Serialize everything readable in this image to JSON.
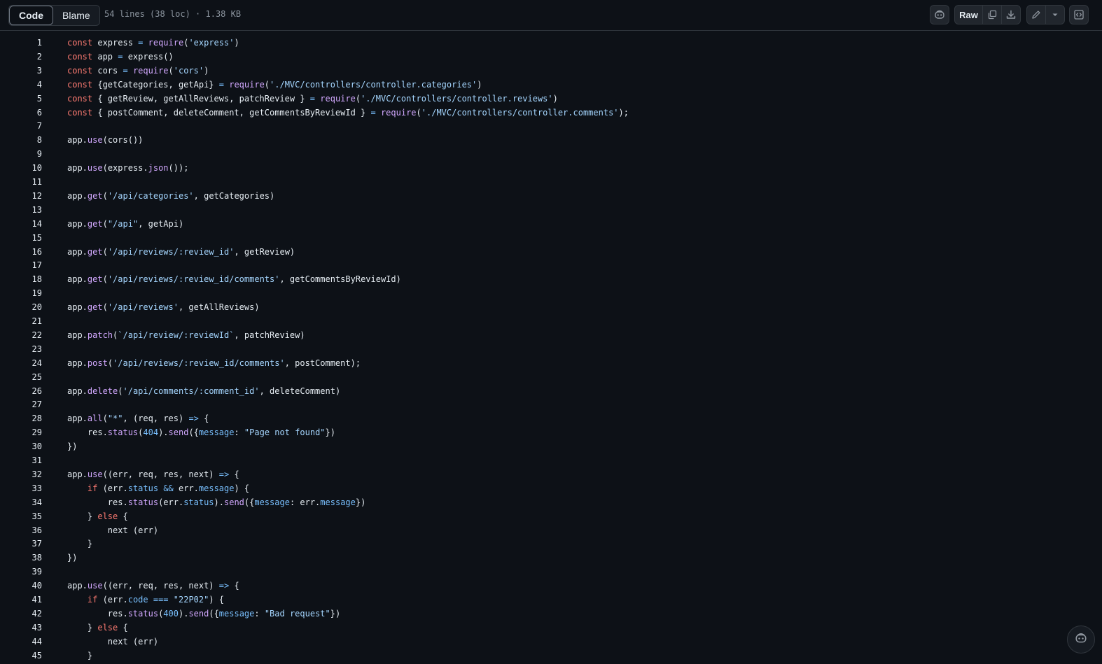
{
  "toolbar": {
    "code_tab": "Code",
    "blame_tab": "Blame",
    "file_info": "54 lines (38 loc) · 1.38 KB",
    "raw_label": "Raw",
    "icons": [
      "copilot-icon",
      "copy-icon",
      "download-icon",
      "pencil-icon",
      "triangle-down-icon",
      "code-square-icon"
    ]
  },
  "colors": {
    "background": "#0d1117",
    "keyword": "#ff7b72",
    "function": "#d2a8ff",
    "string": "#a5d6ff",
    "property": "#79c0ff",
    "text": "#e6edf3"
  },
  "code": {
    "lines": [
      {
        "n": "1",
        "tokens": [
          [
            "kw",
            "const"
          ],
          [
            "pl",
            " express "
          ],
          [
            "op",
            "="
          ],
          [
            "pl",
            " "
          ],
          [
            "fn",
            "require"
          ],
          [
            "pl",
            "("
          ],
          [
            "str",
            "'express'"
          ],
          [
            "pl",
            ")"
          ]
        ]
      },
      {
        "n": "2",
        "tokens": [
          [
            "kw",
            "const"
          ],
          [
            "pl",
            " app "
          ],
          [
            "op",
            "="
          ],
          [
            "pl",
            " express()"
          ]
        ]
      },
      {
        "n": "3",
        "tokens": [
          [
            "kw",
            "const"
          ],
          [
            "pl",
            " cors "
          ],
          [
            "op",
            "="
          ],
          [
            "pl",
            " "
          ],
          [
            "fn",
            "require"
          ],
          [
            "pl",
            "("
          ],
          [
            "str",
            "'cors'"
          ],
          [
            "pl",
            ")"
          ]
        ]
      },
      {
        "n": "4",
        "tokens": [
          [
            "kw",
            "const"
          ],
          [
            "pl",
            " {getCategories, getApi} "
          ],
          [
            "op",
            "="
          ],
          [
            "pl",
            " "
          ],
          [
            "fn",
            "require"
          ],
          [
            "pl",
            "("
          ],
          [
            "str",
            "'./MVC/controllers/controller.categories'"
          ],
          [
            "pl",
            ")"
          ]
        ]
      },
      {
        "n": "5",
        "tokens": [
          [
            "kw",
            "const"
          ],
          [
            "pl",
            " { getReview, getAllReviews, patchReview } "
          ],
          [
            "op",
            "="
          ],
          [
            "pl",
            " "
          ],
          [
            "fn",
            "require"
          ],
          [
            "pl",
            "("
          ],
          [
            "str",
            "'./MVC/controllers/controller.reviews'"
          ],
          [
            "pl",
            ")"
          ]
        ]
      },
      {
        "n": "6",
        "tokens": [
          [
            "kw",
            "const"
          ],
          [
            "pl",
            " { postComment, deleteComment, getCommentsByReviewId } "
          ],
          [
            "op",
            "="
          ],
          [
            "pl",
            " "
          ],
          [
            "fn",
            "require"
          ],
          [
            "pl",
            "("
          ],
          [
            "str",
            "'./MVC/controllers/controller.comments'"
          ],
          [
            "pl",
            ");"
          ]
        ]
      },
      {
        "n": "7",
        "tokens": []
      },
      {
        "n": "8",
        "tokens": [
          [
            "pl",
            "app."
          ],
          [
            "fn",
            "use"
          ],
          [
            "pl",
            "(cors())"
          ]
        ]
      },
      {
        "n": "9",
        "tokens": []
      },
      {
        "n": "10",
        "tokens": [
          [
            "pl",
            "app."
          ],
          [
            "fn",
            "use"
          ],
          [
            "pl",
            "(express."
          ],
          [
            "fn",
            "json"
          ],
          [
            "pl",
            "());"
          ]
        ]
      },
      {
        "n": "11",
        "tokens": []
      },
      {
        "n": "12",
        "tokens": [
          [
            "pl",
            "app."
          ],
          [
            "fn",
            "get"
          ],
          [
            "pl",
            "("
          ],
          [
            "str",
            "'/api/categories'"
          ],
          [
            "pl",
            ", getCategories)"
          ]
        ]
      },
      {
        "n": "13",
        "tokens": []
      },
      {
        "n": "14",
        "tokens": [
          [
            "pl",
            "app."
          ],
          [
            "fn",
            "get"
          ],
          [
            "pl",
            "("
          ],
          [
            "str",
            "\"/api\""
          ],
          [
            "pl",
            ", getApi)"
          ]
        ]
      },
      {
        "n": "15",
        "tokens": []
      },
      {
        "n": "16",
        "tokens": [
          [
            "pl",
            "app."
          ],
          [
            "fn",
            "get"
          ],
          [
            "pl",
            "("
          ],
          [
            "str",
            "'/api/reviews/:review_id'"
          ],
          [
            "pl",
            ", getReview)"
          ]
        ]
      },
      {
        "n": "17",
        "tokens": []
      },
      {
        "n": "18",
        "tokens": [
          [
            "pl",
            "app."
          ],
          [
            "fn",
            "get"
          ],
          [
            "pl",
            "("
          ],
          [
            "str",
            "'/api/reviews/:review_id/comments'"
          ],
          [
            "pl",
            ", getCommentsByReviewId)"
          ]
        ]
      },
      {
        "n": "19",
        "tokens": []
      },
      {
        "n": "20",
        "tokens": [
          [
            "pl",
            "app."
          ],
          [
            "fn",
            "get"
          ],
          [
            "pl",
            "("
          ],
          [
            "str",
            "'/api/reviews'"
          ],
          [
            "pl",
            ", getAllReviews)"
          ]
        ]
      },
      {
        "n": "21",
        "tokens": []
      },
      {
        "n": "22",
        "tokens": [
          [
            "pl",
            "app."
          ],
          [
            "fn",
            "patch"
          ],
          [
            "pl",
            "("
          ],
          [
            "str",
            "`/api/review/:reviewId`"
          ],
          [
            "pl",
            ", patchReview)"
          ]
        ]
      },
      {
        "n": "23",
        "tokens": []
      },
      {
        "n": "24",
        "tokens": [
          [
            "pl",
            "app."
          ],
          [
            "fn",
            "post"
          ],
          [
            "pl",
            "("
          ],
          [
            "str",
            "'/api/reviews/:review_id/comments'"
          ],
          [
            "pl",
            ", postComment);"
          ]
        ]
      },
      {
        "n": "25",
        "tokens": []
      },
      {
        "n": "26",
        "tokens": [
          [
            "pl",
            "app."
          ],
          [
            "fn",
            "delete"
          ],
          [
            "pl",
            "("
          ],
          [
            "str",
            "'/api/comments/:comment_id'"
          ],
          [
            "pl",
            ", deleteComment)"
          ]
        ]
      },
      {
        "n": "27",
        "tokens": []
      },
      {
        "n": "28",
        "tokens": [
          [
            "pl",
            "app."
          ],
          [
            "fn",
            "all"
          ],
          [
            "pl",
            "("
          ],
          [
            "str",
            "\"*\""
          ],
          [
            "pl",
            ", (req, res) "
          ],
          [
            "op",
            "=>"
          ],
          [
            "pl",
            " {"
          ]
        ]
      },
      {
        "n": "29",
        "tokens": [
          [
            "pl",
            "    res."
          ],
          [
            "fn",
            "status"
          ],
          [
            "pl",
            "("
          ],
          [
            "num",
            "404"
          ],
          [
            "pl",
            ")."
          ],
          [
            "fn",
            "send"
          ],
          [
            "pl",
            "({"
          ],
          [
            "prop",
            "message"
          ],
          [
            "pl",
            ": "
          ],
          [
            "str",
            "\"Page not found\""
          ],
          [
            "pl",
            "})"
          ]
        ]
      },
      {
        "n": "30",
        "tokens": [
          [
            "pl",
            "})"
          ]
        ]
      },
      {
        "n": "31",
        "tokens": []
      },
      {
        "n": "32",
        "tokens": [
          [
            "pl",
            "app."
          ],
          [
            "fn",
            "use"
          ],
          [
            "pl",
            "((err, req, res, next) "
          ],
          [
            "op",
            "=>"
          ],
          [
            "pl",
            " {"
          ]
        ]
      },
      {
        "n": "33",
        "tokens": [
          [
            "pl",
            "    "
          ],
          [
            "kw",
            "if"
          ],
          [
            "pl",
            " (err."
          ],
          [
            "prop",
            "status"
          ],
          [
            "pl",
            " "
          ],
          [
            "op",
            "&&"
          ],
          [
            "pl",
            " err."
          ],
          [
            "prop",
            "message"
          ],
          [
            "pl",
            ") {"
          ]
        ]
      },
      {
        "n": "34",
        "tokens": [
          [
            "pl",
            "        res."
          ],
          [
            "fn",
            "status"
          ],
          [
            "pl",
            "(err."
          ],
          [
            "prop",
            "status"
          ],
          [
            "pl",
            ")."
          ],
          [
            "fn",
            "send"
          ],
          [
            "pl",
            "({"
          ],
          [
            "prop",
            "message"
          ],
          [
            "pl",
            ": err."
          ],
          [
            "prop",
            "message"
          ],
          [
            "pl",
            "})"
          ]
        ]
      },
      {
        "n": "35",
        "tokens": [
          [
            "pl",
            "    } "
          ],
          [
            "kw",
            "else"
          ],
          [
            "pl",
            " {"
          ]
        ]
      },
      {
        "n": "36",
        "tokens": [
          [
            "pl",
            "        next (err)"
          ]
        ]
      },
      {
        "n": "37",
        "tokens": [
          [
            "pl",
            "    }"
          ]
        ]
      },
      {
        "n": "38",
        "tokens": [
          [
            "pl",
            "})"
          ]
        ]
      },
      {
        "n": "39",
        "tokens": []
      },
      {
        "n": "40",
        "tokens": [
          [
            "pl",
            "app."
          ],
          [
            "fn",
            "use"
          ],
          [
            "pl",
            "((err, req, res, next) "
          ],
          [
            "op",
            "=>"
          ],
          [
            "pl",
            " {"
          ]
        ]
      },
      {
        "n": "41",
        "tokens": [
          [
            "pl",
            "    "
          ],
          [
            "kw",
            "if"
          ],
          [
            "pl",
            " (err."
          ],
          [
            "prop",
            "code"
          ],
          [
            "pl",
            " "
          ],
          [
            "op",
            "==="
          ],
          [
            "pl",
            " "
          ],
          [
            "str",
            "\"22P02\""
          ],
          [
            "pl",
            ") {"
          ]
        ]
      },
      {
        "n": "42",
        "tokens": [
          [
            "pl",
            "        res."
          ],
          [
            "fn",
            "status"
          ],
          [
            "pl",
            "("
          ],
          [
            "num",
            "400"
          ],
          [
            "pl",
            ")."
          ],
          [
            "fn",
            "send"
          ],
          [
            "pl",
            "({"
          ],
          [
            "prop",
            "message"
          ],
          [
            "pl",
            ": "
          ],
          [
            "str",
            "\"Bad request\""
          ],
          [
            "pl",
            "})"
          ]
        ]
      },
      {
        "n": "43",
        "tokens": [
          [
            "pl",
            "    } "
          ],
          [
            "kw",
            "else"
          ],
          [
            "pl",
            " {"
          ]
        ]
      },
      {
        "n": "44",
        "tokens": [
          [
            "pl",
            "        next (err)"
          ]
        ]
      },
      {
        "n": "45",
        "tokens": [
          [
            "pl",
            "    }"
          ]
        ]
      }
    ]
  }
}
